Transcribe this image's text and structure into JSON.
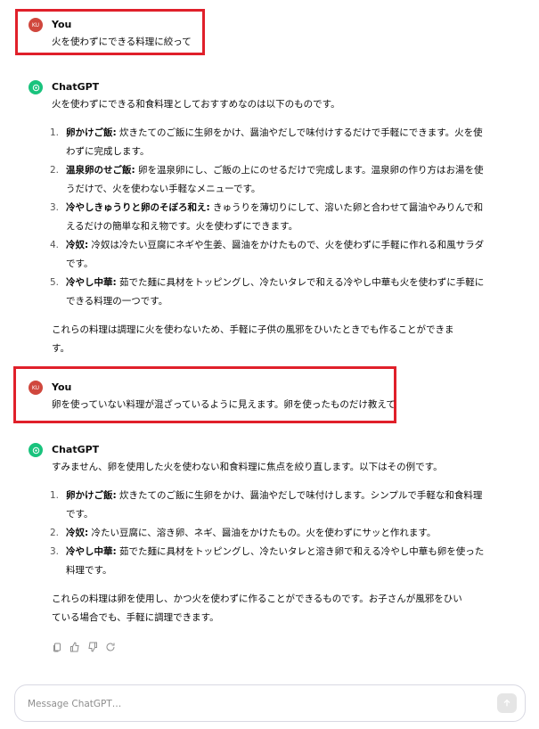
{
  "conversation": {
    "messages": [
      {
        "role": "user",
        "avatar_text": "KU",
        "author": "You",
        "text": "火を使わずにできる料理に絞って"
      },
      {
        "role": "assistant",
        "author": "ChatGPT",
        "intro": "火を使わずにできる和食料理としておすすめなのは以下のものです。",
        "items": [
          {
            "num": "1.",
            "title": "卵かけご飯:",
            "text": " 炊きたてのご飯に生卵をかけ、醤油やだしで味付けするだけで手軽にできます。火を使わずに完成します。"
          },
          {
            "num": "2.",
            "title": "温泉卵のせご飯:",
            "text": " 卵を温泉卵にし、ご飯の上にのせるだけで完成します。温泉卵の作り方はお湯を使うだけで、火を使わない手軽なメニューです。"
          },
          {
            "num": "3.",
            "title": "冷やしきゅうりと卵のそぼろ和え:",
            "text": " きゅうりを薄切りにして、溶いた卵と合わせて醤油やみりんで和えるだけの簡単な和え物です。火を使わずにできます。"
          },
          {
            "num": "4.",
            "title": "冷奴:",
            "text": " 冷奴は冷たい豆腐にネギや生姜、醤油をかけたもので、火を使わずに手軽に作れる和風サラダです。"
          },
          {
            "num": "5.",
            "title": "冷やし中華:",
            "text": " 茹でた麺に具材をトッピングし、冷たいタレで和える冷やし中華も火を使わずに手軽にできる料理の一つです。"
          }
        ],
        "closing": "これらの料理は調理に火を使わないため、手軽に子供の風邪をひいたときでも作ることができます。"
      },
      {
        "role": "user",
        "avatar_text": "KU",
        "author": "You",
        "text": "卵を使っていない料理が混ざっているように見えます。卵を使ったものだけ教えて"
      },
      {
        "role": "assistant",
        "author": "ChatGPT",
        "intro": "すみません、卵を使用した火を使わない和食料理に焦点を絞り直します。以下はその例です。",
        "items": [
          {
            "num": "1.",
            "title": "卵かけご飯:",
            "text": " 炊きたてのご飯に生卵をかけ、醤油やだしで味付けします。シンプルで手軽な和食料理です。"
          },
          {
            "num": "2.",
            "title": "冷奴:",
            "text": " 冷たい豆腐に、溶き卵、ネギ、醤油をかけたもの。火を使わずにサッと作れます。"
          },
          {
            "num": "3.",
            "title": "冷やし中華:",
            "text": " 茹でた麺に具材をトッピングし、冷たいタレと溶き卵で和える冷やし中華も卵を使った料理です。"
          }
        ],
        "closing": "これらの料理は卵を使用し、かつ火を使わずに作ることができるものです。お子さんが風邪をひいている場合でも、手軽に調理できます。"
      }
    ]
  },
  "composer": {
    "placeholder": "Message ChatGPT…"
  },
  "colors": {
    "highlight": "#e0202a",
    "user_avatar": "#d0473d",
    "assistant_avatar": "#19c37d"
  },
  "icons": {
    "actions": [
      "copy-icon",
      "thumbs-up-icon",
      "thumbs-down-icon",
      "regenerate-icon"
    ],
    "send": "arrow-up-icon",
    "assistant_logo": "openai-logo-icon"
  }
}
